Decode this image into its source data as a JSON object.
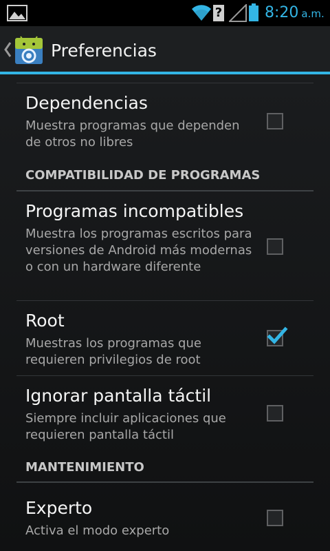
{
  "status_bar": {
    "time": "8:20",
    "ampm": "a.m.",
    "unknown_glyph": "?",
    "icons": [
      "gallery-icon",
      "wifi-icon",
      "unknown-icon",
      "signal-icon",
      "battery-icon"
    ],
    "accent_color": "#33b5e5"
  },
  "action_bar": {
    "title": "Preferencias",
    "accent_color": "#33b5e5"
  },
  "preferences": [
    {
      "key": "dependencias",
      "title": "Dependencias",
      "summary": "Muestra programas que dependen de otros no libres",
      "checked": false
    },
    {
      "key": "incompatibles",
      "title": "Programas incompatibles",
      "summary": "Muestra los programas escritos para versiones de Android más modernas o con un hardware diferente",
      "checked": false
    },
    {
      "key": "root",
      "title": "Root",
      "summary": "Muestras los programas que requieren privilegios de root",
      "checked": true
    },
    {
      "key": "ignorar-tactil",
      "title": "Ignorar pantalla táctil",
      "summary": "Siempre incluir aplicaciones que requieren pantalla táctil",
      "checked": false
    },
    {
      "key": "experto",
      "title": "Experto",
      "summary": "Activa el modo experto",
      "checked": false
    }
  ],
  "categories": {
    "compatibilidad": "COMPATIBILIDAD DE PROGRAMAS",
    "mantenimiento": "MANTENIMIENTO"
  }
}
